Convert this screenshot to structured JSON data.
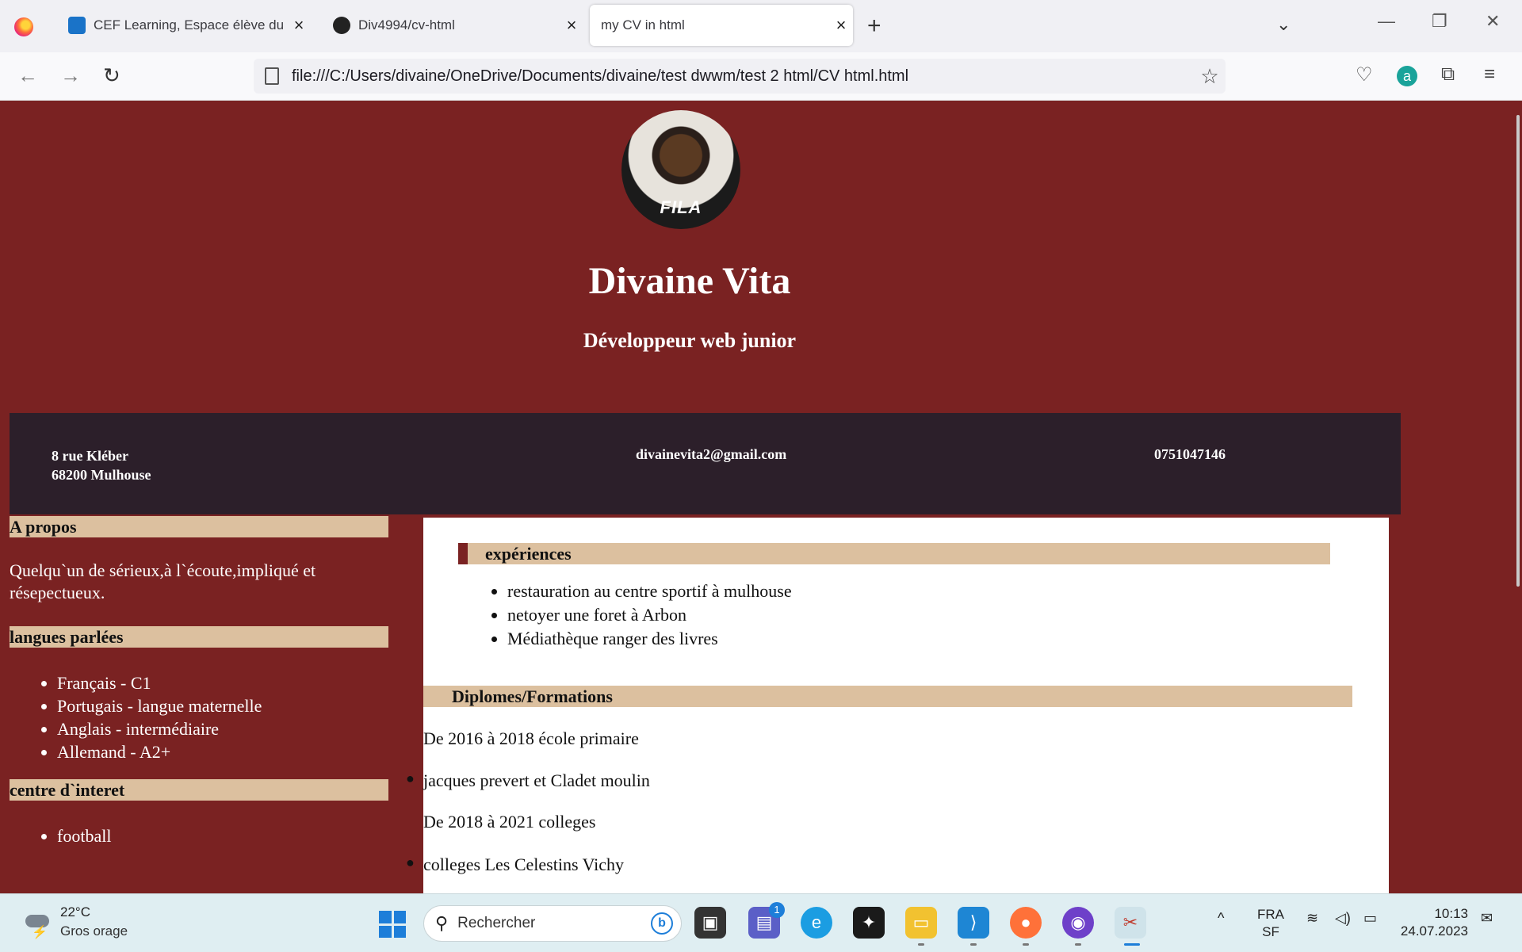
{
  "browser": {
    "tabs": [
      {
        "title": "CEF Learning, Espace élève du C",
        "active": false
      },
      {
        "title": "Div4994/cv-html",
        "active": false
      },
      {
        "title": "my CV in html",
        "active": true
      }
    ],
    "url": "file:///C:/Users/divaine/OneDrive/Documents/divaine/test dwwm/test 2 html/CV html.html"
  },
  "cv": {
    "photo_text": "FILA",
    "name": "Divaine Vita",
    "role": "Développeur web junior",
    "contact": {
      "address_line1": "8 rue Kléber",
      "address_line2": "68200 Mulhouse",
      "email": "divainevita2@gmail.com",
      "phone": "0751047146"
    },
    "about": {
      "heading": "A propos",
      "text": "Quelqu`un de sérieux,à l`écoute,impliqué et résepectueux."
    },
    "languages": {
      "heading": "langues parlées",
      "items": [
        "Français - C1",
        "Portugais - langue maternelle",
        "Anglais - intermédiaire",
        "Allemand - A2+"
      ]
    },
    "interests": {
      "heading": "centre d`interet",
      "items": [
        "football"
      ]
    },
    "experiences": {
      "heading": "expériences",
      "items": [
        "restauration au centre sportif à mulhouse",
        "netoyer une foret à Arbon",
        "Médiathèque ranger des livres"
      ]
    },
    "diplomas": {
      "heading": "Diplomes/Formations",
      "lines": [
        "De 2016 à 2018 école primaire",
        "jacques prevert et Cladet moulin",
        "De 2018 à 2021 colleges",
        "colleges Les Celestins Vichy"
      ]
    }
  },
  "taskbar": {
    "temperature": "22°C",
    "weather": "Gros orage",
    "search_placeholder": "Rechercher",
    "teams_badge": "1",
    "lang_line1": "FRA",
    "lang_line2": "SF",
    "time": "10:13",
    "date": "24.07.2023"
  }
}
